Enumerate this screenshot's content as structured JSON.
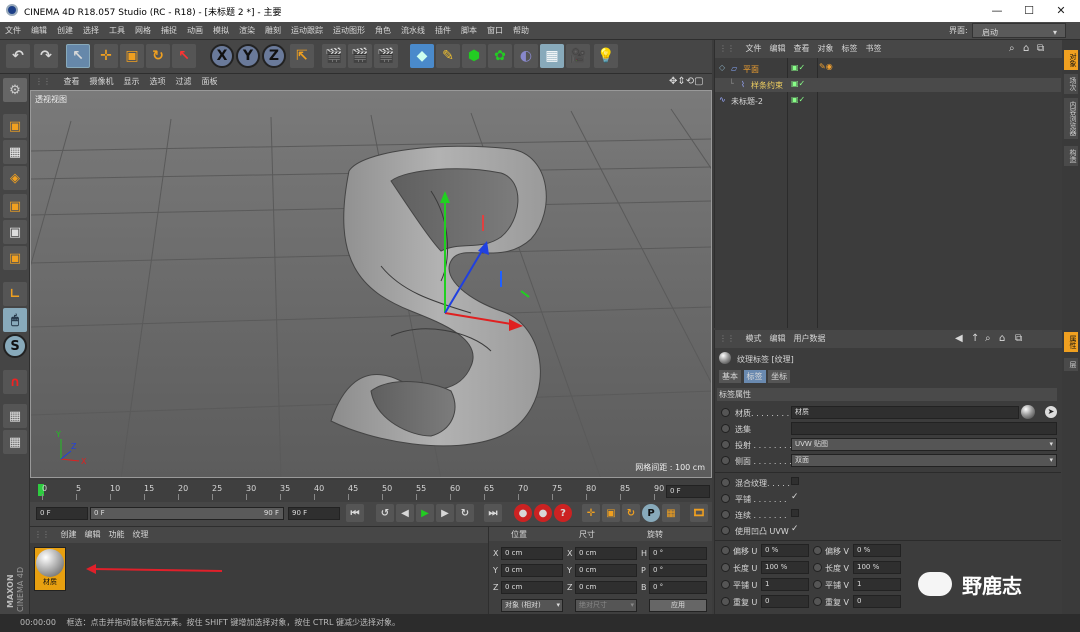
{
  "window": {
    "title": "CINEMA 4D R18.057 Studio (RC - R18) - [未标题 2 *] - 主要",
    "minimize": "—",
    "maximize": "☐",
    "close": "✕"
  },
  "menubar": {
    "items": [
      "文件",
      "编辑",
      "创建",
      "选择",
      "工具",
      "网格",
      "捕捉",
      "动画",
      "模拟",
      "渲染",
      "雕刻",
      "运动跟踪",
      "运动图形",
      "角色",
      "流水线",
      "插件",
      "脚本",
      "窗口",
      "帮助"
    ],
    "layout_label": "界面:",
    "layout_value": "启动"
  },
  "toolbar": {
    "x": "X",
    "y": "Y",
    "z": "Z"
  },
  "left_tools": {
    "s": "S"
  },
  "viewport": {
    "menu": [
      "查看",
      "摄像机",
      "显示",
      "选项",
      "过滤",
      "面板"
    ],
    "label": "透视视图",
    "grid_spacing": "网格间距 : 100 cm",
    "axis_x": "X",
    "axis_y": "Y",
    "axis_z": "Z"
  },
  "timeline": {
    "ticks": [
      "0",
      "5",
      "10",
      "15",
      "20",
      "25",
      "30",
      "35",
      "40",
      "45",
      "50",
      "55",
      "60",
      "65",
      "70",
      "75",
      "80",
      "85",
      "90"
    ],
    "current": "0 F"
  },
  "transport": {
    "start": "0 F",
    "min": "0 F",
    "max": "90 F",
    "end": "90 F",
    "p": "P"
  },
  "materials": {
    "menu": [
      "创建",
      "编辑",
      "功能",
      "纹理"
    ],
    "item_label": "材质",
    "brand_line1": "MAXON",
    "brand_line2": "CINEMA 4D"
  },
  "coords": {
    "headers": [
      "位置",
      "尺寸",
      "旋转"
    ],
    "rows": [
      {
        "a": "X",
        "v1": "0 cm",
        "b": "X",
        "v2": "0 cm",
        "c": "H",
        "v3": "0 °"
      },
      {
        "a": "Y",
        "v1": "0 cm",
        "b": "Y",
        "v2": "0 cm",
        "c": "P",
        "v3": "0 °"
      },
      {
        "a": "Z",
        "v1": "0 cm",
        "b": "Z",
        "v2": "0 cm",
        "c": "B",
        "v3": "0 °"
      }
    ],
    "mode": "对象 (相对)",
    "size_mode": "绝对尺寸",
    "apply": "应用"
  },
  "object_manager": {
    "menu": [
      "文件",
      "编辑",
      "查看",
      "对象",
      "标签",
      "书签"
    ],
    "objects": [
      {
        "name": "平面",
        "color": "#f0a030"
      },
      {
        "name": "样条约束",
        "color": "#f0d060"
      },
      {
        "name": "未标题-2",
        "color": "#d8d8d8"
      }
    ]
  },
  "attributes": {
    "menu": [
      "模式",
      "编辑",
      "用户数据"
    ],
    "title": "纹理标签 [纹理]",
    "tabs": [
      "基本",
      "标签",
      "坐标"
    ],
    "section": "标签属性",
    "material_label": "材质. . . . . . . . .",
    "material_value": "材质",
    "selection_label": "选集",
    "projection_label": "投射 . . . . . . . .",
    "projection_value": "UVW 贴图",
    "side_label": "侧面 . . . . . . . .",
    "side_value": "双面",
    "checks": [
      {
        "label": "混合纹理. . . . .",
        "value": ""
      },
      {
        "label": "平铺 . . . . . . .",
        "value": "✓"
      },
      {
        "label": "连续 . . . . . . .",
        "value": ""
      },
      {
        "label": "使用凹凸 UVW",
        "value": "✓"
      }
    ],
    "params": [
      {
        "l1": "偏移 U",
        "v1": "0 %",
        "l2": "偏移 V",
        "v2": "0 %"
      },
      {
        "l1": "长度 U",
        "v1": "100 %",
        "l2": "长度 V",
        "v2": "100 %"
      },
      {
        "l1": "平铺 U",
        "v1": "1",
        "l2": "平铺 V",
        "v2": "1"
      },
      {
        "l1": "重复 U",
        "v1": "0",
        "l2": "重复 V",
        "v2": "0"
      }
    ]
  },
  "right_tabs": [
    "对象",
    "场次",
    "内容浏览器",
    "构造",
    "属性",
    "层"
  ],
  "watermark": "野鹿志",
  "status": {
    "time": "00:00:00",
    "text": "框选：点击并拖动鼠标框选元素。按住 SHIFT 键增加选择对象，按住 CTRL 键减少选择对象。"
  },
  "colors": {
    "accent_orange": "#f0a020",
    "axis_x": "#e02020",
    "axis_y": "#20d020",
    "axis_z": "#2040e0",
    "arrow_red": "#e0202a"
  }
}
